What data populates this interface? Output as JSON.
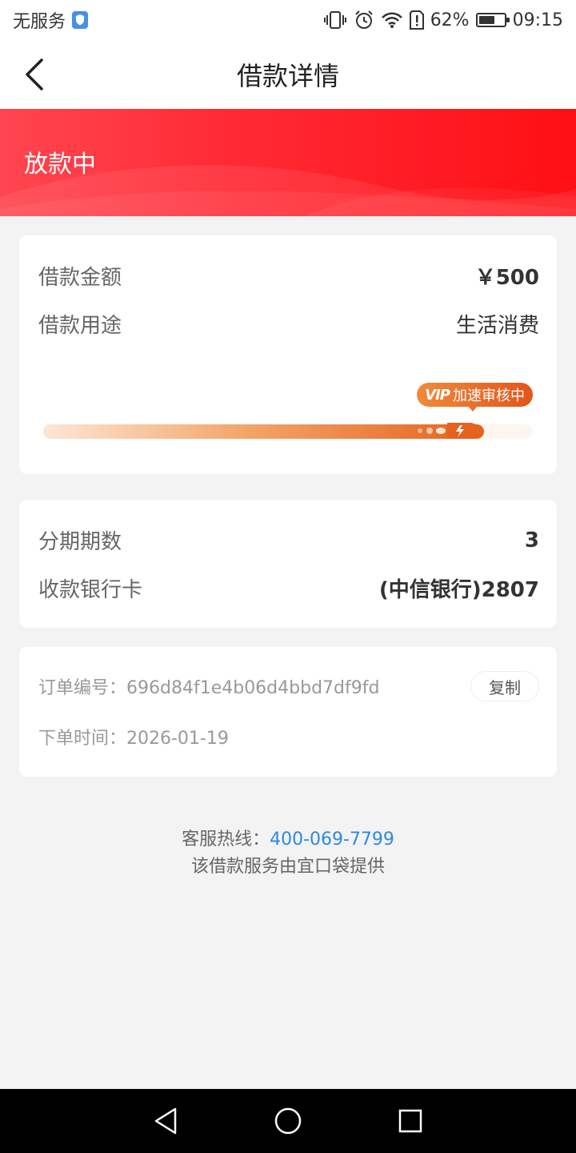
{
  "status_bar": {
    "carrier": "无服务",
    "battery": "62%",
    "battery_level": 0.62,
    "time": "09:15",
    "icons": [
      "shield-icon",
      "vibrate-icon",
      "alarm-icon",
      "wifi-icon",
      "alert-icon",
      "battery-icon"
    ]
  },
  "header": {
    "title": "借款详情",
    "back_icon": "back-chevron-icon"
  },
  "banner": {
    "status": "放款中",
    "color": "#ff1e25"
  },
  "loan_card": {
    "amount_label": "借款金额",
    "amount_value": "￥500",
    "purpose_label": "借款用途",
    "purpose_value": "生活消费",
    "vip_tag": "VIP",
    "vip_text": "加速审核中",
    "progress": 0.9
  },
  "installment_card": {
    "periods_label": "分期期数",
    "periods_value": "3",
    "bank_label": "收款银行卡",
    "bank_value": "(中信银行)2807"
  },
  "order_card": {
    "order_no": "订单编号：696d84f1e4b06d4bbd7df9fd",
    "copy_label": "复制",
    "order_time": "下单时间：2026-01-19"
  },
  "footer": {
    "hotline_label": "客服热线：",
    "hotline_number": "400-069-7799",
    "provider": "该借款服务由宜口袋提供"
  },
  "system_nav": {
    "icons": [
      "nav-back-icon",
      "nav-home-icon",
      "nav-recents-icon"
    ]
  }
}
